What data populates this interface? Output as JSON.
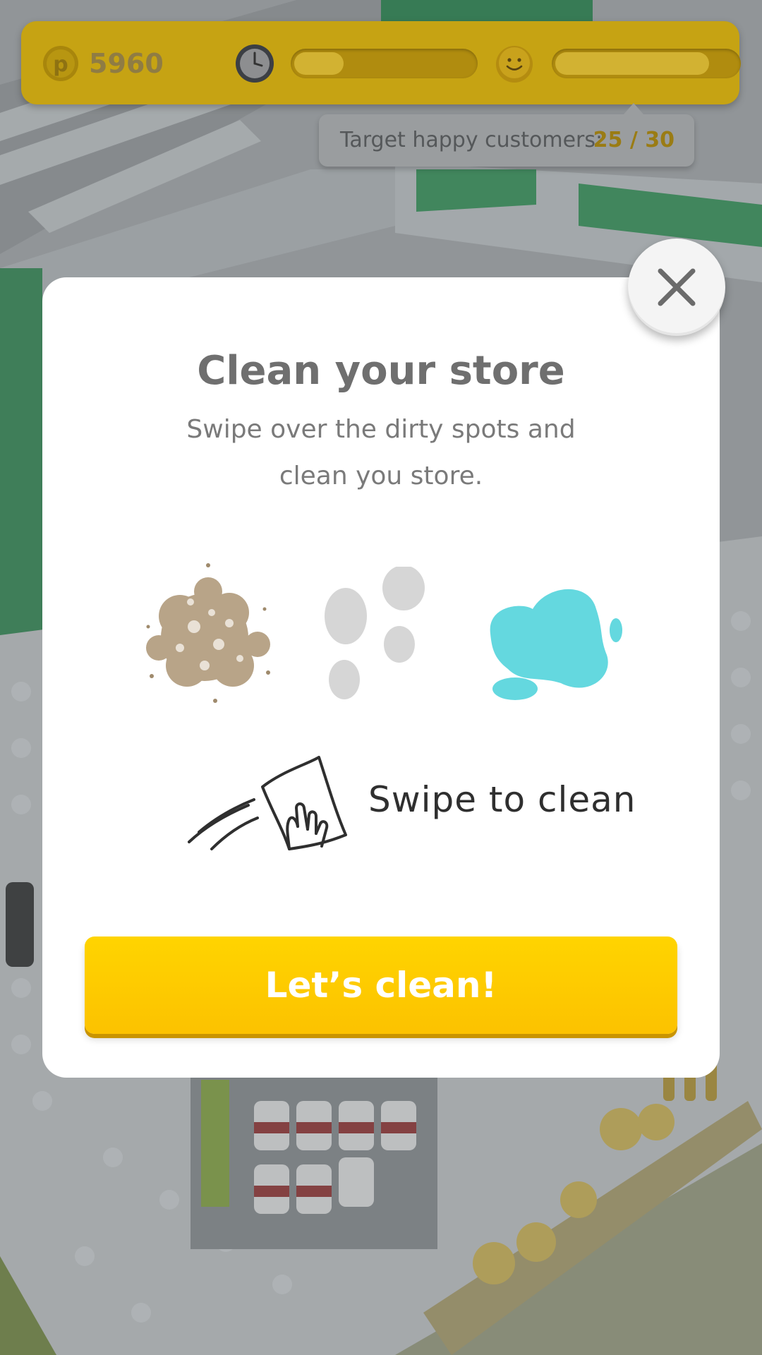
{
  "hud": {
    "coins": "5960",
    "time_progress": 0.3,
    "happiness_progress": 0.85
  },
  "target": {
    "label": "Target happy customers:",
    "value": "25 / 30"
  },
  "modal": {
    "title": "Clean your store",
    "description": "Swipe over the dirty spots and clean you store.",
    "swipe_label": "Swipe to clean",
    "cta_label": "Let’s clean!"
  },
  "icons": [
    "coin-icon",
    "clock-icon",
    "smiley-icon",
    "close-icon",
    "dirt-icon",
    "footprints-icon",
    "puddle-icon",
    "swipe-cloth-icon"
  ],
  "colors": {
    "hud_bg": "#c6a313",
    "accent_yellow": "#ffd400",
    "puddle": "#64d8df",
    "dirt": "#b8a488"
  }
}
